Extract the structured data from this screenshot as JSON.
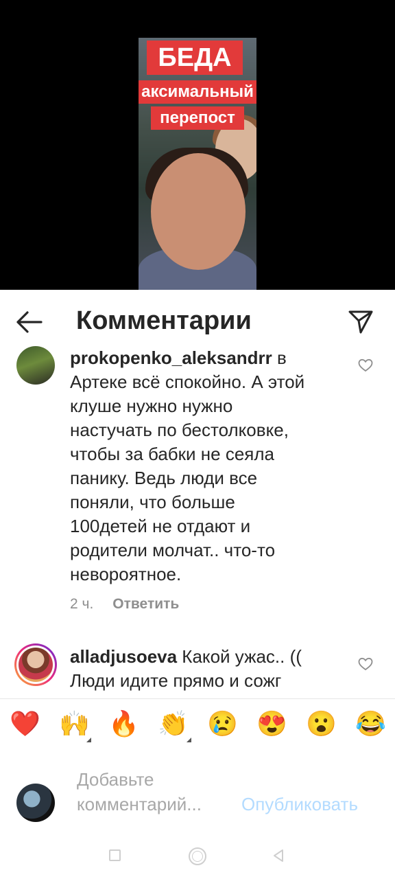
{
  "video": {
    "banner_line1": "БЕДА",
    "banner_line2": "аксимальный",
    "banner_line3": "перепост"
  },
  "header": {
    "title": "Комментарии",
    "back_icon": "back-arrow-icon",
    "share_icon": "send-icon"
  },
  "comments": [
    {
      "username": "prokopenko_aleksandrr",
      "text": " в Артеке всё спокойно. А этой клуше нужно нужно настучать по бестолковке, чтобы за бабки не сеяла панику. Ведь люди все поняли, что больше 100детей не отдают и родители молчат.. что-то невороятное.",
      "time": "2 ч.",
      "reply_label": "Ответить"
    },
    {
      "username": "alladjusoeva",
      "text": " Какой ужас.. (( Люди идите прямо и сожг"
    }
  ],
  "emoji_bar": [
    "❤️",
    "🙌",
    "🔥",
    "👏",
    "😢",
    "😍",
    "😮",
    "😂"
  ],
  "compose": {
    "placeholder": "Добавьте комментарий...",
    "publish_label": "Опубликовать"
  },
  "colors": {
    "publish_disabled": "#b3dbff",
    "secondary_text": "#8e8e8e",
    "banner_red": "#e23a3a"
  }
}
